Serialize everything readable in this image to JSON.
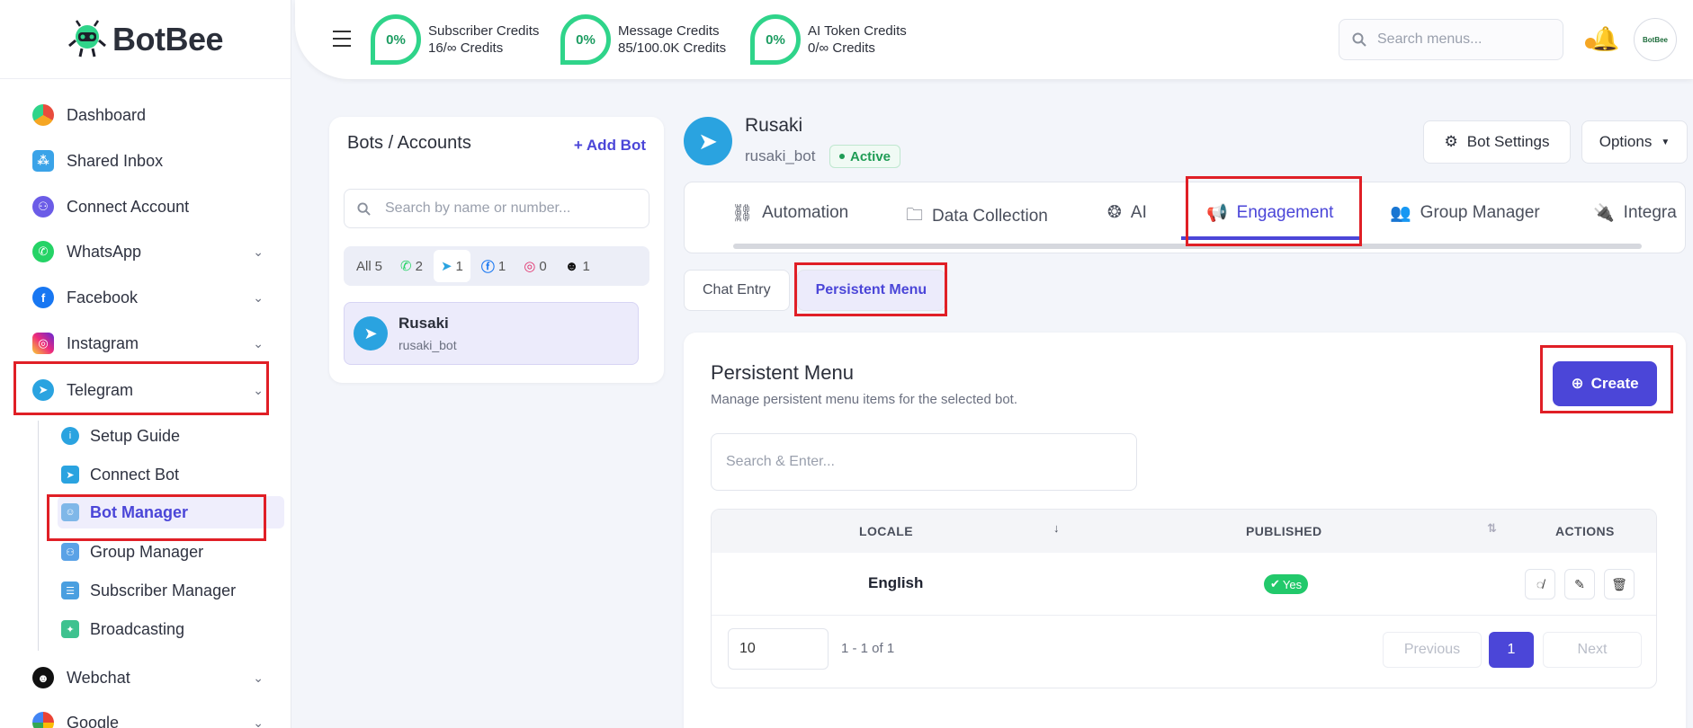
{
  "brand": {
    "name": "BotBee"
  },
  "sidebar": {
    "items": [
      {
        "label": "Dashboard",
        "icon": "dashboard-icon"
      },
      {
        "label": "Shared Inbox",
        "icon": "shared-inbox-icon"
      },
      {
        "label": "Connect Account",
        "icon": "connect-account-icon"
      },
      {
        "label": "WhatsApp",
        "icon": "whatsapp-icon"
      },
      {
        "label": "Facebook",
        "icon": "facebook-icon"
      },
      {
        "label": "Instagram",
        "icon": "instagram-icon"
      },
      {
        "label": "Telegram",
        "icon": "telegram-icon"
      },
      {
        "label": "Webchat",
        "icon": "webchat-icon"
      },
      {
        "label": "Google",
        "icon": "google-icon"
      }
    ],
    "telegram_sub": [
      {
        "label": "Setup Guide"
      },
      {
        "label": "Connect Bot"
      },
      {
        "label": "Bot Manager"
      },
      {
        "label": "Group Manager"
      },
      {
        "label": "Subscriber Manager"
      },
      {
        "label": "Broadcasting"
      }
    ]
  },
  "topbar": {
    "credits": [
      {
        "percent": "0%",
        "title": "Subscriber Credits",
        "value": "16/∞ Credits"
      },
      {
        "percent": "0%",
        "title": "Message Credits",
        "value": "85/100.0K Credits"
      },
      {
        "percent": "0%",
        "title": "AI Token Credits",
        "value": "0/∞ Credits"
      }
    ],
    "search_placeholder": "Search menus...",
    "avatar_text": "BotBee"
  },
  "bots_panel": {
    "title": "Bots / Accounts",
    "add_label": "Add Bot",
    "search_placeholder": "Search by name or number...",
    "filters": [
      {
        "label": "All",
        "count": "5"
      },
      {
        "icon": "whatsapp-icon",
        "count": "2"
      },
      {
        "icon": "telegram-icon",
        "count": "1"
      },
      {
        "icon": "facebook-icon",
        "count": "1"
      },
      {
        "icon": "instagram-icon",
        "count": "0"
      },
      {
        "icon": "webchat-icon",
        "count": "1"
      }
    ],
    "bot": {
      "name": "Rusaki",
      "username": "rusaki_bot"
    }
  },
  "bot_header": {
    "name": "Rusaki",
    "username": "rusaki_bot",
    "status": "Active",
    "settings_label": "Bot Settings",
    "options_label": "Options"
  },
  "tabs": [
    {
      "label": "Automation",
      "icon": "automation-icon"
    },
    {
      "label": "Data Collection",
      "icon": "folder-icon"
    },
    {
      "label": "AI",
      "icon": "brain-icon"
    },
    {
      "label": "Engagement",
      "icon": "megaphone-icon"
    },
    {
      "label": "Group Manager",
      "icon": "users-icon"
    },
    {
      "label": "Integra",
      "icon": "plug-icon"
    }
  ],
  "subtabs": [
    {
      "label": "Chat Entry"
    },
    {
      "label": "Persistent Menu"
    }
  ],
  "content": {
    "title": "Persistent Menu",
    "subtitle": "Manage persistent menu items for the selected bot.",
    "create_label": "Create",
    "search_placeholder": "Search & Enter...",
    "columns": {
      "locale": "LOCALE",
      "published": "PUBLISHED",
      "actions": "ACTIONS"
    },
    "rows": [
      {
        "locale": "English",
        "published": "Yes"
      }
    ],
    "pagination": {
      "per_page": "10",
      "info": "1 - 1 of 1",
      "prev": "Previous",
      "page": "1",
      "next": "Next"
    }
  },
  "colors": {
    "accent": "#4b46d8",
    "highlight": "#e01f26",
    "success": "#22c96b",
    "telegram": "#2aa3e0"
  }
}
